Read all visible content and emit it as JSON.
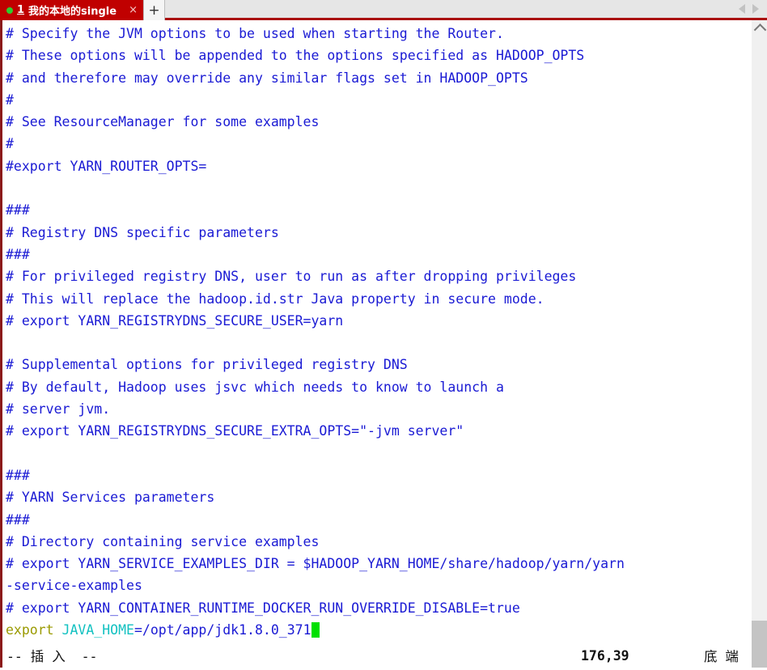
{
  "tabbar": {
    "tab": {
      "index": "1",
      "title": "我的本地的single",
      "close_label": "×",
      "status_dot": "connected"
    },
    "new_tab_label": "+",
    "nav_prev_label": "prev",
    "nav_next_label": "next"
  },
  "editor": {
    "lines": [
      {
        "segments": [
          {
            "text": "# Specify the JVM options to be used when starting the Router.",
            "cls": "c-comment"
          }
        ]
      },
      {
        "segments": [
          {
            "text": "# These options will be appended to the options specified as HADOOP_OPTS",
            "cls": "c-comment"
          }
        ]
      },
      {
        "segments": [
          {
            "text": "# and therefore may override any similar flags set in HADOOP_OPTS",
            "cls": "c-comment"
          }
        ]
      },
      {
        "segments": [
          {
            "text": "#",
            "cls": "c-comment"
          }
        ]
      },
      {
        "segments": [
          {
            "text": "# See ResourceManager for some examples",
            "cls": "c-comment"
          }
        ]
      },
      {
        "segments": [
          {
            "text": "#",
            "cls": "c-comment"
          }
        ]
      },
      {
        "segments": [
          {
            "text": "#export YARN_ROUTER_OPTS=",
            "cls": "c-comment"
          }
        ]
      },
      {
        "segments": [
          {
            "text": "",
            "cls": "c-comment"
          }
        ]
      },
      {
        "segments": [
          {
            "text": "###",
            "cls": "c-comment"
          }
        ]
      },
      {
        "segments": [
          {
            "text": "# Registry DNS specific parameters",
            "cls": "c-comment"
          }
        ]
      },
      {
        "segments": [
          {
            "text": "###",
            "cls": "c-comment"
          }
        ]
      },
      {
        "segments": [
          {
            "text": "# For privileged registry DNS, user to run as after dropping privileges",
            "cls": "c-comment"
          }
        ]
      },
      {
        "segments": [
          {
            "text": "# This will replace the hadoop.id.str Java property in secure mode.",
            "cls": "c-comment"
          }
        ]
      },
      {
        "segments": [
          {
            "text": "# export YARN_REGISTRYDNS_SECURE_USER=yarn",
            "cls": "c-comment"
          }
        ]
      },
      {
        "segments": [
          {
            "text": "",
            "cls": "c-comment"
          }
        ]
      },
      {
        "segments": [
          {
            "text": "# Supplemental options for privileged registry DNS",
            "cls": "c-comment"
          }
        ]
      },
      {
        "segments": [
          {
            "text": "# By default, Hadoop uses jsvc which needs to know to launch a",
            "cls": "c-comment"
          }
        ]
      },
      {
        "segments": [
          {
            "text": "# server jvm.",
            "cls": "c-comment"
          }
        ]
      },
      {
        "segments": [
          {
            "text": "# export YARN_REGISTRYDNS_SECURE_EXTRA_OPTS=\"-jvm server\"",
            "cls": "c-comment"
          }
        ]
      },
      {
        "segments": [
          {
            "text": "",
            "cls": "c-comment"
          }
        ]
      },
      {
        "segments": [
          {
            "text": "###",
            "cls": "c-comment"
          }
        ]
      },
      {
        "segments": [
          {
            "text": "# YARN Services parameters",
            "cls": "c-comment"
          }
        ]
      },
      {
        "segments": [
          {
            "text": "###",
            "cls": "c-comment"
          }
        ]
      },
      {
        "segments": [
          {
            "text": "# Directory containing service examples",
            "cls": "c-comment"
          }
        ]
      },
      {
        "segments": [
          {
            "text": "# export YARN_SERVICE_EXAMPLES_DIR = $HADOOP_YARN_HOME/share/hadoop/yarn/yarn",
            "cls": "c-comment"
          }
        ]
      },
      {
        "segments": [
          {
            "text": "-service-examples",
            "cls": "c-comment"
          }
        ]
      },
      {
        "segments": [
          {
            "text": "# export YARN_CONTAINER_RUNTIME_DOCKER_RUN_OVERRIDE_DISABLE=true",
            "cls": "c-comment"
          }
        ]
      },
      {
        "segments": [
          {
            "text": "export ",
            "cls": "c-keyword"
          },
          {
            "text": "JAVA_HOME",
            "cls": "c-ident"
          },
          {
            "text": "=/opt/app/jdk1.8.0_371",
            "cls": "c-value"
          }
        ],
        "cursor": true
      }
    ]
  },
  "statusbar": {
    "mode": "-- 插 入  --",
    "position": "176,39",
    "location": "底 端"
  },
  "colors": {
    "tab_active_bg": "#c00000",
    "comment": "#1a1ad4",
    "keyword": "#9a9a00",
    "identifier": "#13c1c1",
    "cursor": "#00e000",
    "left_border": "#8b1a1a"
  }
}
